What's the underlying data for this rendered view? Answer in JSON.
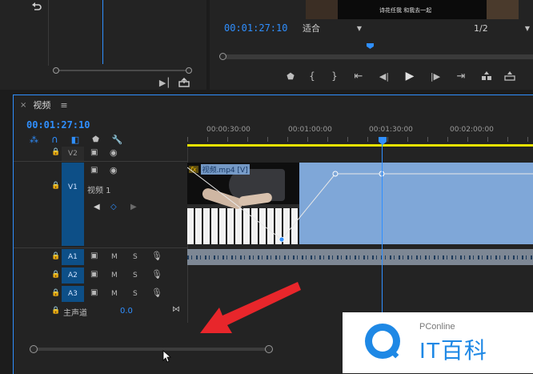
{
  "source_monitor": {
    "icon": "undo-icon"
  },
  "program_monitor": {
    "timecode": "00:01:27:10",
    "fit_label": "适合",
    "resolution": "1/2",
    "subtitle_lines": [
      "诗花任我 和我去一起"
    ],
    "transport": [
      {
        "name": "marker-button",
        "glyph": "⯃"
      },
      {
        "name": "in-point-button",
        "glyph": "{"
      },
      {
        "name": "out-point-button",
        "glyph": "}"
      },
      {
        "name": "go-to-in-button",
        "glyph": "⇤"
      },
      {
        "name": "step-back-button",
        "glyph": "◀"
      },
      {
        "name": "play-button",
        "glyph": "▶"
      },
      {
        "name": "step-forward-button",
        "glyph": "▶"
      },
      {
        "name": "go-to-out-button",
        "glyph": "⇥"
      },
      {
        "name": "lift-button",
        "glyph": "⎘"
      },
      {
        "name": "extract-button",
        "glyph": "⎗"
      }
    ]
  },
  "timeline": {
    "tab_label": "视频",
    "timecode": "00:01:27:10",
    "ruler": [
      "00:00:30:00",
      "00:01:00:00",
      "00:01:30:00",
      "00:02:00:00"
    ],
    "tracks": {
      "v2": "V2",
      "v1": "V1",
      "v1_name": "视频 1",
      "a1": "A1",
      "a2": "A2",
      "a3": "A3",
      "master": "主声道",
      "master_value": "0.0"
    },
    "clip_label": "视频.mp4 [V]",
    "fx_badge": "fx",
    "m_label": "M",
    "s_label": "S"
  },
  "watermark": {
    "brand": "PConline",
    "title": "IT百科"
  },
  "colors": {
    "accent_blue": "#2f8fff",
    "track_blue": "#0d4f87",
    "clip_blue": "#7fa7d8",
    "arrow_red": "#e8262b",
    "playhead": "#2f8fff",
    "work_area": "#e6e200"
  }
}
